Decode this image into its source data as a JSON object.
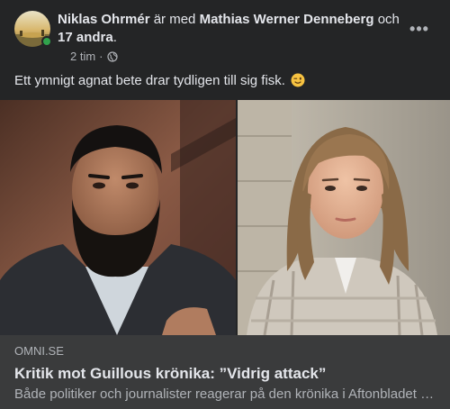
{
  "post": {
    "author": "Niklas Ohrmér",
    "with_text": "är med",
    "tagged_person": "Mathias Werner Denneberg",
    "and_text": "och",
    "others": "17 andra",
    "time": "2 tim",
    "dot": "·",
    "privacy_icon": "globe-icon",
    "more_label": "•••",
    "text": "Ett ymnigt agnat bete drar tydligen till sig fisk.",
    "emoji": "winking-face-emoji"
  },
  "link_preview": {
    "domain": "OMNI.SE",
    "title": "Kritik mot Guillous krönika: ”Vidrig attack”",
    "description": "Både politiker och journalister reagerar på den krönika i Aftonbladet som Jan Guillou skrev"
  },
  "colors": {
    "background": "#242526",
    "link_box": "#3a3b3c",
    "primary_text": "#e4e6eb",
    "secondary_text": "#b0b3b8",
    "online": "#31a24c"
  }
}
